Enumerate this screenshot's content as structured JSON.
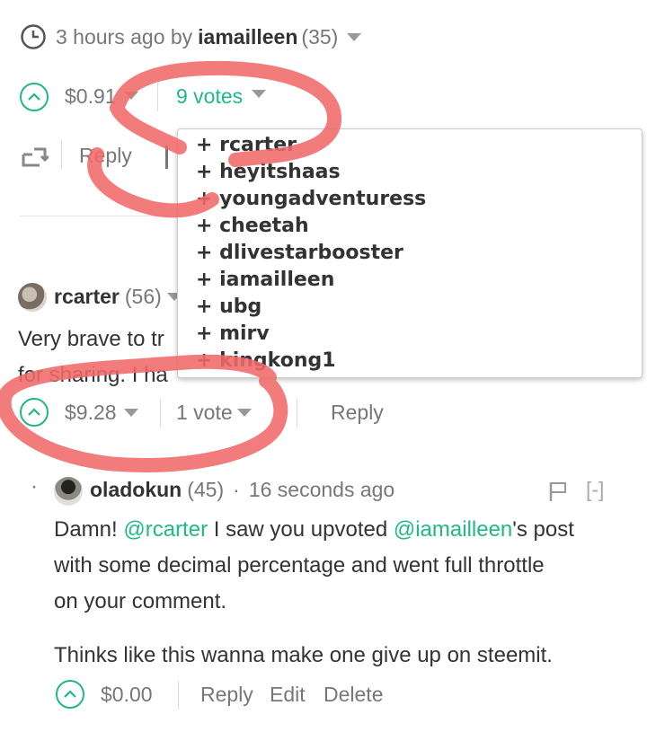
{
  "post_meta": {
    "time_ago": "3 hours ago by",
    "author": "iamailleen",
    "reputation": "(35)"
  },
  "post_footer": {
    "payout": "$0.91",
    "votes": "9 votes",
    "reply": "Reply"
  },
  "voters_dropdown": {
    "items": [
      "+ rcarter",
      "+ heyitshaas",
      "+ youngadventuress",
      "+ cheetah",
      "+ dlivestarbooster",
      "+ iamailleen",
      "+ ubg",
      "+ mirv",
      "+ kingkong1"
    ]
  },
  "comment1": {
    "author": "rcarter",
    "reputation": "(56)",
    "text_line1": "Very brave to tr",
    "text_line2": "for sharing. I ha",
    "payout": "$9.28",
    "votes": "1 vote",
    "reply": "Reply"
  },
  "comment2": {
    "bullet": "·",
    "author": "oladokun",
    "reputation": "(45)",
    "dot": "·",
    "time_ago": "16 seconds ago",
    "collapse": "[-]",
    "p1_a": "Damn! ",
    "p1_mention1": "@rcarter",
    "p1_b": " I saw you upvoted ",
    "p1_mention2": "@iamailleen",
    "p1_c": "'s post",
    "p1_line2": "with some decimal percentage and went full throttle",
    "p1_line3": "on your comment.",
    "p2": "Thinks like this wanna make one give up on steemit.",
    "payout": "$0.00",
    "reply": "Reply",
    "edit": "Edit",
    "delete": "Delete"
  },
  "colors": {
    "accent": "#1fb985",
    "annotation": "#f06a6a"
  }
}
